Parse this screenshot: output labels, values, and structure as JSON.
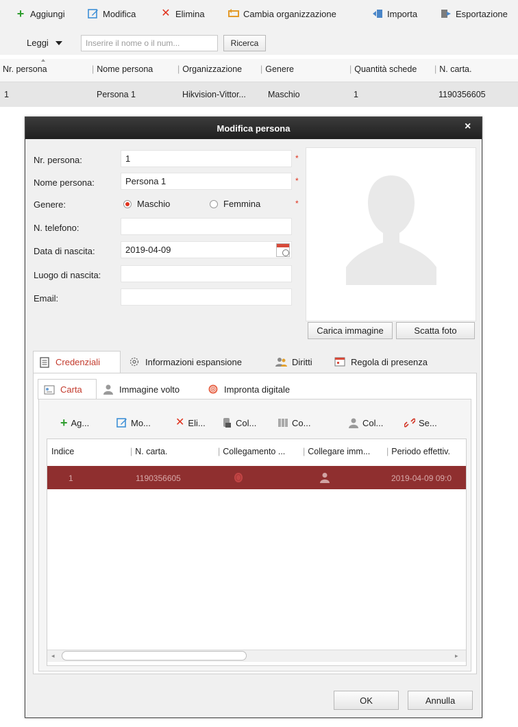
{
  "toolbar": {
    "add": "Aggiungi",
    "edit": "Modifica",
    "delete": "Elimina",
    "change_org": "Cambia organizzazione",
    "import": "Importa",
    "export": "Esportazione"
  },
  "search": {
    "mode": "Leggi",
    "placeholder": "Inserire il nome o il num...",
    "button": "Ricerca"
  },
  "main_table": {
    "headers": [
      "Nr. persona",
      "Nome persona",
      "Organizzazione",
      "Genere",
      "Quantità schede",
      "N. carta."
    ],
    "rows": [
      [
        "1",
        "Persona 1",
        "Hikvision-Vittor...",
        "Maschio",
        "1",
        "1190356605"
      ]
    ]
  },
  "dialog": {
    "title": "Modifica persona",
    "close": "×",
    "form": {
      "person_no_label": "Nr. persona:",
      "person_no_value": "1",
      "name_label": "Nome persona:",
      "name_value": "Persona 1",
      "gender_label": "Genere:",
      "gender_male": "Maschio",
      "gender_female": "Femmina",
      "phone_label": "N. telefono:",
      "phone_value": "",
      "birth_date_label": "Data di nascita:",
      "birth_date_value": "2019-04-09",
      "birth_place_label": "Luogo di nascita:",
      "birth_place_value": "",
      "email_label": "Email:",
      "email_value": "",
      "required_mark": "*"
    },
    "photo": {
      "upload": "Carica immagine",
      "take": "Scatta foto"
    },
    "tabs": [
      "Credenziali",
      "Informazioni espansione",
      "Diritti",
      "Regola di presenza"
    ],
    "subtabs": [
      "Carta",
      "Immagine volto",
      "Impronta digitale"
    ],
    "card_toolbar": [
      "Ag...",
      "Mo...",
      "Eli...",
      "Col...",
      "Co...",
      "Col...",
      "Se..."
    ],
    "card_table": {
      "headers": [
        "Indice",
        "N. carta.",
        "Collegamento ...",
        "Collegare imm...",
        "Periodo effettiv."
      ],
      "rows": [
        {
          "index": "1",
          "card_no": "1190356605",
          "period": "2019-04-09 09:0"
        }
      ]
    },
    "ok": "OK",
    "cancel": "Annulla"
  },
  "colors": {
    "accent_red": "#c33a2c",
    "selected_row": "#8f2f2f",
    "title_bar": "#2a2a2a"
  }
}
